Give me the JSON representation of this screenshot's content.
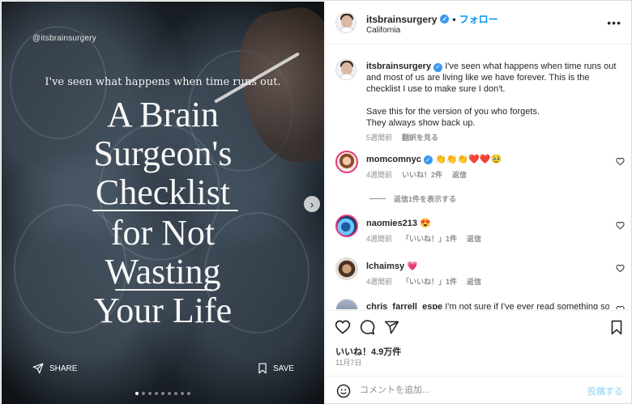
{
  "media": {
    "handle": "@itsbrainsurgery",
    "kicker": "I've seen what happens when time runs out.",
    "headline_lines": [
      "A Brain",
      "Surgeon's",
      "Checklist",
      "for Not",
      "Wasting",
      "Your Life"
    ],
    "share_label": "SHARE",
    "save_label": "SAVE",
    "carousel": {
      "total": 9,
      "active_index": 0
    }
  },
  "header": {
    "username": "itsbrainsurgery",
    "separator": "•",
    "follow_label": "フォロー",
    "location": "California",
    "more_label": "•••"
  },
  "caption": {
    "username": "itsbrainsurgery",
    "text": "I've seen what happens when time runs out and most of us are living like we have forever. This is the checklist I use to make sure I don't.",
    "text2_line1": "Save this for the version of you who forgets.",
    "text2_line2": "They always show back up.",
    "time": "5週間前",
    "translate_label": "翻訳を見る"
  },
  "comments": [
    {
      "username": "momcomnyc",
      "verified": true,
      "text": "👏👏👏❤️❤️🥹",
      "time": "4週間前",
      "likes": "いいね！2件",
      "reply": "返信"
    },
    {
      "username": "naomies213",
      "verified": false,
      "text": "😍",
      "time": "4週間前",
      "likes": "「いいね！」1件",
      "reply": "返信"
    },
    {
      "username": "lchaimsy",
      "verified": false,
      "text": "💗",
      "time": "4週間前",
      "likes": "「いいね！」1件",
      "reply": "返信"
    },
    {
      "username": "chris_farrell_espe",
      "verified": false,
      "text": "I'm not sure if I've ever read something so",
      "time": "",
      "likes": "",
      "reply": ""
    }
  ],
  "view_replies_label": "返信1件を表示する",
  "engagement": {
    "likes": "いいね！4.9万件",
    "date": "11月7日"
  },
  "add_comment": {
    "placeholder": "コメントを追加...",
    "post_label": "投稿する"
  },
  "colors": {
    "accent": "#0095f6",
    "verified": "#3897f0",
    "muted_text": "#8e8e8e",
    "post_disabled": "#b2dffc"
  },
  "icons": [
    "verified-badge-icon",
    "more-options-icon",
    "heart-icon",
    "comment-icon",
    "share-icon",
    "bookmark-icon",
    "emoji-icon",
    "next-arrow-icon",
    "share-plane-icon",
    "save-bookmark-icon"
  ]
}
